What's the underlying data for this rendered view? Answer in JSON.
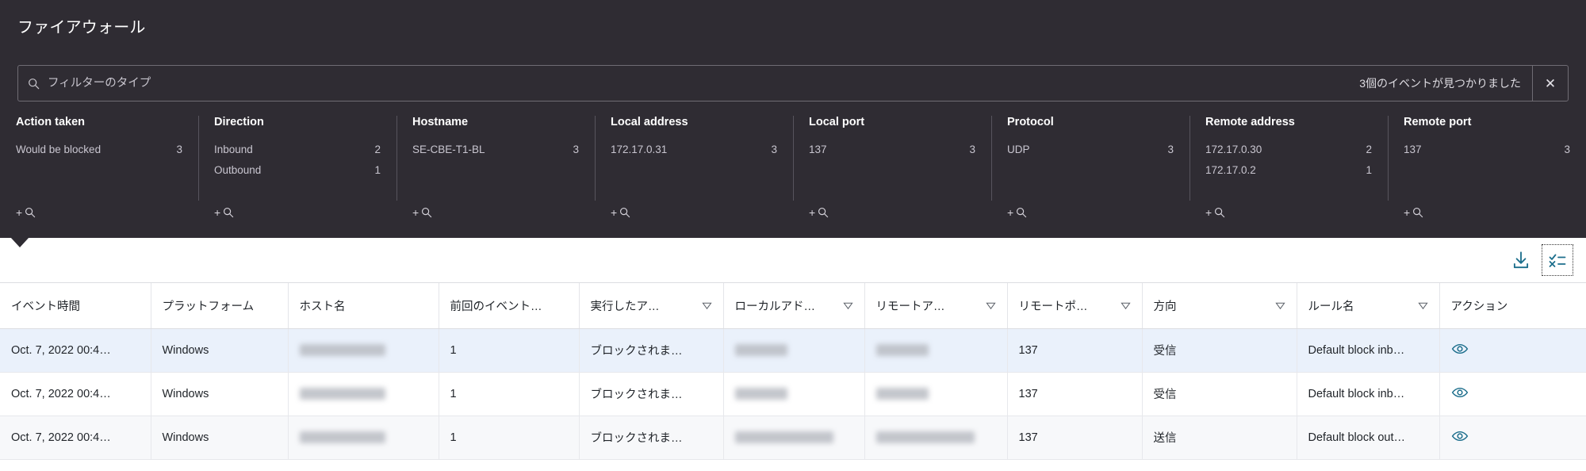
{
  "page": {
    "title": "ファイアウォール"
  },
  "filter_bar": {
    "icon": "search-icon",
    "placeholder": "フィルターのタイプ",
    "value": "",
    "result_count_text": "3個のイベントが見つかりました",
    "clear_label": "✕"
  },
  "facets": [
    {
      "title": "Action taken",
      "rows": [
        {
          "label": "Would be blocked",
          "count": "3"
        }
      ],
      "add_label": "+"
    },
    {
      "title": "Direction",
      "rows": [
        {
          "label": "Inbound",
          "count": "2"
        },
        {
          "label": "Outbound",
          "count": "1"
        }
      ],
      "add_label": "+"
    },
    {
      "title": "Hostname",
      "rows": [
        {
          "label": "SE-CBE-T1-BL",
          "count": "3"
        }
      ],
      "add_label": "+"
    },
    {
      "title": "Local address",
      "rows": [
        {
          "label": "172.17.0.31",
          "count": "3"
        }
      ],
      "add_label": "+"
    },
    {
      "title": "Local port",
      "rows": [
        {
          "label": "137",
          "count": "3"
        }
      ],
      "add_label": "+"
    },
    {
      "title": "Protocol",
      "rows": [
        {
          "label": "UDP",
          "count": "3"
        }
      ],
      "add_label": "+"
    },
    {
      "title": "Remote address",
      "rows": [
        {
          "label": "172.17.0.30",
          "count": "2"
        },
        {
          "label": "172.17.0.2",
          "count": "1"
        }
      ],
      "add_label": "+"
    },
    {
      "title": "Remote port",
      "rows": [
        {
          "label": "137",
          "count": "3"
        }
      ],
      "add_label": "+"
    }
  ],
  "toolbar": {
    "download_icon": "download-icon",
    "columns_icon": "column-chooser-icon"
  },
  "table": {
    "columns": [
      {
        "label": "イベント時間",
        "filter": false
      },
      {
        "label": "プラットフォーム",
        "filter": false
      },
      {
        "label": "ホスト名",
        "filter": false
      },
      {
        "label": "前回のイベント…",
        "filter": false
      },
      {
        "label": "実行したア…",
        "filter": true
      },
      {
        "label": "ローカルアド…",
        "filter": true
      },
      {
        "label": "リモートア…",
        "filter": true
      },
      {
        "label": "リモートポ…",
        "filter": true
      },
      {
        "label": "方向",
        "filter": true
      },
      {
        "label": "ルール名",
        "filter": true
      },
      {
        "label": "アクション",
        "filter": false
      }
    ],
    "rows": [
      {
        "state": "row-sel",
        "event_time": "Oct. 7, 2022 00:4…",
        "platform": "Windows",
        "hostname": "",
        "previous_event_count": "1",
        "action_taken": "ブロックされま…",
        "local_address": "",
        "remote_address": "",
        "remote_port": "137",
        "direction": "受信",
        "rule_name": "Default block inb…",
        "action_icon": "eye-icon"
      },
      {
        "state": "row-plain",
        "event_time": "Oct. 7, 2022 00:4…",
        "platform": "Windows",
        "hostname": "",
        "previous_event_count": "1",
        "action_taken": "ブロックされま…",
        "local_address": "",
        "remote_address": "",
        "remote_port": "137",
        "direction": "受信",
        "rule_name": "Default block inb…",
        "action_icon": "eye-icon"
      },
      {
        "state": "row-alt",
        "event_time": "Oct. 7, 2022 00:4…",
        "platform": "Windows",
        "hostname": "",
        "previous_event_count": "1",
        "action_taken": "ブロックされま…",
        "local_address": "",
        "remote_address": "",
        "remote_port": "137",
        "direction": "送信",
        "rule_name": "Default block out…",
        "action_icon": "eye-icon"
      }
    ],
    "redacted_widths": [
      {
        "hostname": "w-short",
        "local_address": "w-mid",
        "remote_address": "w-mid"
      },
      {
        "hostname": "w-short",
        "local_address": "w-mid",
        "remote_address": "w-mid"
      },
      {
        "hostname": "w-short",
        "local_address": "w-long",
        "remote_address": "w-long"
      }
    ]
  },
  "colors": {
    "panel_bg": "#2f2c33",
    "accent": "#1c6e8c",
    "row_selected": "#eaf1fb",
    "row_alt": "#f7f8fa"
  }
}
